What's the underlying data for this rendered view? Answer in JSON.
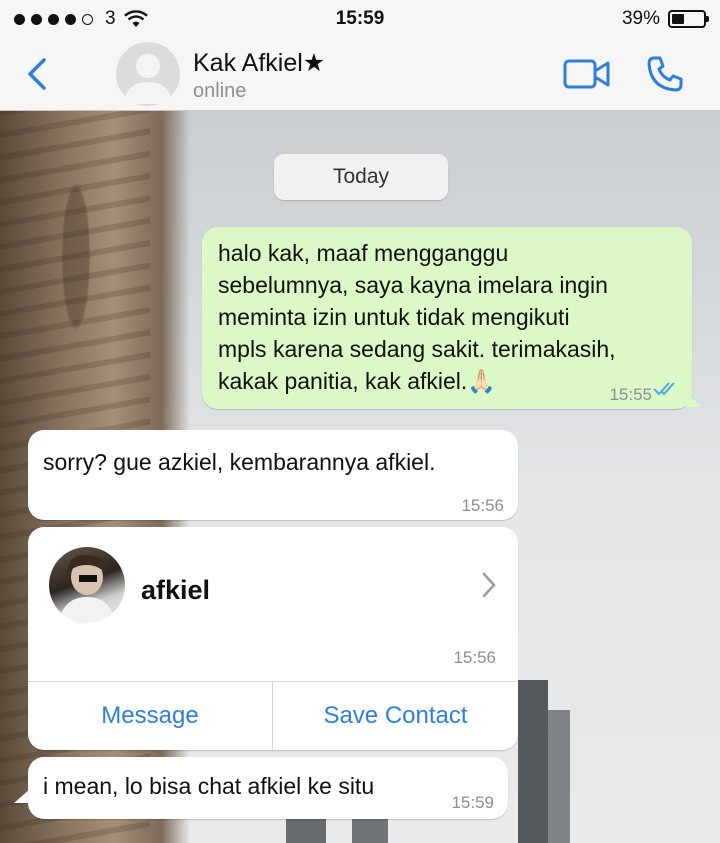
{
  "status_bar": {
    "carrier": "3",
    "time": "15:59",
    "battery_percent": "39%",
    "battery_level": 0.39,
    "signal_bars_filled": 4,
    "signal_bars_total": 5,
    "icons": [
      "wifi-icon",
      "battery-icon"
    ]
  },
  "header": {
    "back_icon": "chevron-left-icon",
    "contact_name": "Kak Afkiel★",
    "contact_status": "online",
    "video_icon": "video-camera-icon",
    "call_icon": "phone-icon",
    "accent_color": "#2e7fdc"
  },
  "chat": {
    "date_label": "Today",
    "messages": [
      {
        "direction": "outgoing",
        "text": "halo kak, maaf mengganggu\nsebelumnya, saya kayna imelara ingin\nmeminta izin untuk tidak mengikuti\nmpls karena sedang sakit. terimakasih,\nkakak panitia, kak afkiel.🙏🏻",
        "time": "15:55",
        "read_icon": "double-check-icon"
      },
      {
        "direction": "incoming",
        "text": "sorry? gue azkiel, kembarannya afkiel.",
        "time": "15:56"
      },
      {
        "direction": "incoming",
        "type": "contact-card",
        "contact_name": "afkiel",
        "time": "15:56",
        "actions": [
          "Message",
          "Save Contact"
        ]
      },
      {
        "direction": "incoming",
        "text": "i mean, lo bisa chat afkiel ke situ",
        "time": "15:59"
      }
    ]
  },
  "colors": {
    "outgoing_bubble": "#dcf8c6",
    "incoming_bubble": "#ffffff",
    "read_receipt": "#4fa7e6"
  }
}
